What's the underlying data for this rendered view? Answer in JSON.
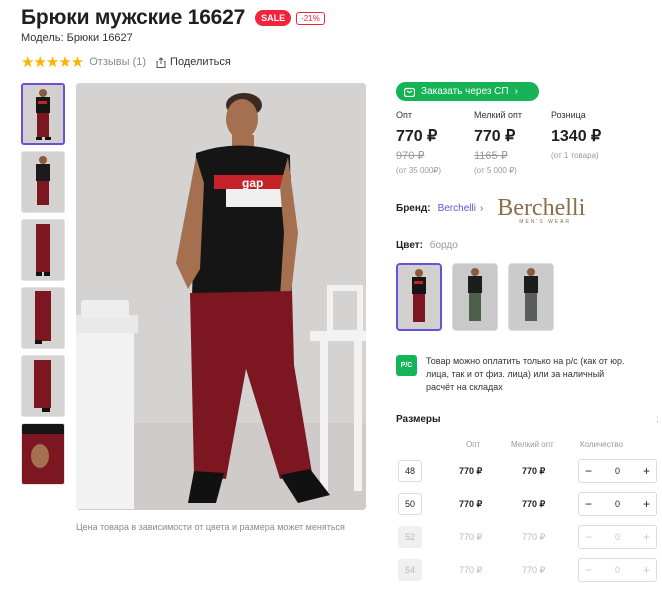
{
  "product": {
    "title": "Брюки мужские 16627",
    "sale_badge": "SALE",
    "discount": "-21%",
    "model": "Модель: Брюки 16627",
    "stars": "★★★★★",
    "reviews": "Отзывы (1)",
    "share": "Поделиться",
    "caption": "Цена товара в зависимости от цвета и размера может меняться"
  },
  "order_button": {
    "label": "Заказать через СП",
    "color": "#15b355"
  },
  "prices": [
    {
      "label": "Опт",
      "value": "770 ₽",
      "old": "970 ₽",
      "note": "(от 35 000₽)"
    },
    {
      "label": "Мелкий опт",
      "value": "770 ₽",
      "old": "1165 ₽",
      "note": "(от 5 000 ₽)"
    },
    {
      "label": "Розница",
      "value": "1340 ₽",
      "old": "",
      "note": "(от 1 товара)"
    }
  ],
  "brand": {
    "label": "Бренд:",
    "name": "Berchelli",
    "logo_text": "Berchelli",
    "logo_sub": "MEN'S WEAR"
  },
  "color": {
    "label": "Цвет:",
    "value": "бордо"
  },
  "payment_note": {
    "icon": "Р/С",
    "text": "Товар можно оплатить только на р/с (как от юр. лица, так и от физ. лица) или за наличный расчёт на складах"
  },
  "sizes": {
    "title": "Размеры",
    "more": ":",
    "headers": {
      "opt": "Опт",
      "small_opt": "Мелкий опт",
      "qty": "Количество"
    },
    "rows": [
      {
        "size": "48",
        "opt": "770 ₽",
        "small_opt": "770 ₽",
        "qty": "0",
        "available": true
      },
      {
        "size": "50",
        "opt": "770 ₽",
        "small_opt": "770 ₽",
        "qty": "0",
        "available": true
      },
      {
        "size": "52",
        "opt": "770 ₽",
        "small_opt": "770 ₽",
        "qty": "0",
        "available": false
      },
      {
        "size": "54",
        "opt": "770 ₽",
        "small_opt": "770 ₽",
        "qty": "0",
        "available": false
      }
    ]
  },
  "colors": {
    "accent": "#6b4fd6",
    "sale": "#f3233b",
    "green": "#15b355",
    "pants": "#7c1620"
  }
}
